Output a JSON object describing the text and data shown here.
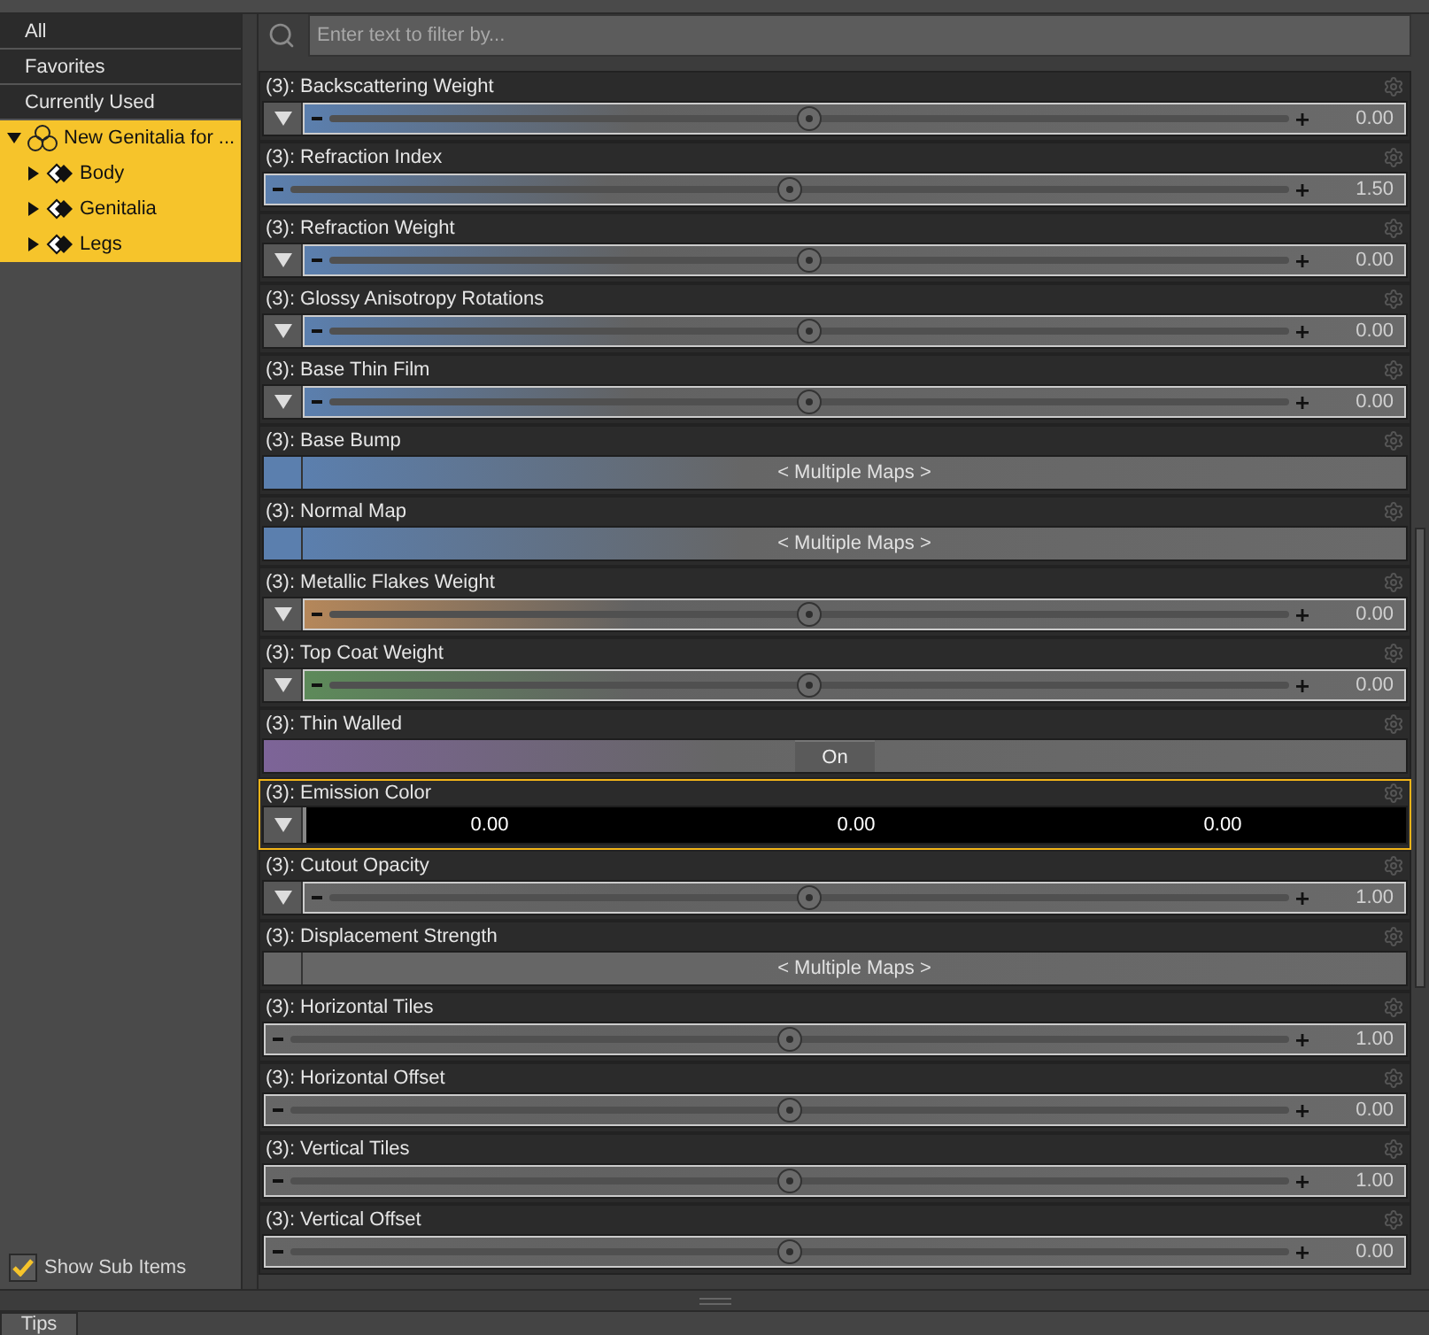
{
  "sidebar": {
    "items": [
      {
        "label": "All",
        "selected": false
      },
      {
        "label": "Favorites",
        "selected": false
      },
      {
        "label": "Currently Used",
        "selected": false
      }
    ],
    "tree": [
      {
        "label": "New Genitalia for ...",
        "selected": true,
        "expanded": true,
        "children": [
          {
            "label": "Body",
            "selected": true,
            "expanded": false
          },
          {
            "label": "Genitalia",
            "selected": true,
            "expanded": false
          },
          {
            "label": "Legs",
            "selected": true,
            "expanded": false
          }
        ]
      }
    ],
    "show_sub_items": {
      "label": "Show Sub Items",
      "checked": true
    }
  },
  "search": {
    "placeholder": "Enter text to filter by..."
  },
  "properties": [
    {
      "kind": "slider",
      "label": "(3): Backscattering Weight",
      "menu": true,
      "color": "#5b7fae",
      "level": 0.5,
      "value": "0.00",
      "selected": false
    },
    {
      "kind": "slider",
      "label": "(3): Refraction Index",
      "menu": false,
      "color": "#5b7fae",
      "level": 0.5,
      "value": "1.50",
      "selected": false
    },
    {
      "kind": "slider",
      "label": "(3): Refraction Weight",
      "menu": true,
      "color": "#5b7fae",
      "level": 0.5,
      "value": "0.00",
      "selected": false
    },
    {
      "kind": "slider",
      "label": "(3): Glossy Anisotropy Rotations",
      "menu": true,
      "color": "#5b7fae",
      "level": 0.5,
      "value": "0.00",
      "selected": false
    },
    {
      "kind": "slider",
      "label": "(3): Base Thin Film",
      "menu": true,
      "color": "#5b7fae",
      "level": 0.5,
      "value": "0.00",
      "selected": false
    },
    {
      "kind": "map",
      "label": "(3): Base Bump",
      "color": "#5b7fae",
      "value": "< Multiple Maps >",
      "selected": false
    },
    {
      "kind": "map",
      "label": "(3): Normal Map",
      "color": "#5b7fae",
      "value": "< Multiple Maps >",
      "selected": false
    },
    {
      "kind": "slider",
      "label": "(3): Metallic Flakes Weight",
      "menu": true,
      "color": "#b5875a",
      "level": 0.5,
      "value": "0.00",
      "selected": false
    },
    {
      "kind": "slider",
      "label": "(3): Top Coat Weight",
      "menu": true,
      "color": "#5d8a5a",
      "level": 0.5,
      "value": "0.00",
      "selected": false
    },
    {
      "kind": "toggle",
      "label": "(3): Thin Walled",
      "color": "#7d6498",
      "value": "On",
      "selected": false
    },
    {
      "kind": "color",
      "label": "(3): Emission Color",
      "values": [
        "0.00",
        "0.00",
        "0.00"
      ],
      "selected": true
    },
    {
      "kind": "slider",
      "label": "(3): Cutout Opacity",
      "menu": true,
      "color": "#666666",
      "level": 0.5,
      "value": "1.00",
      "selected": false
    },
    {
      "kind": "map",
      "label": "(3): Displacement Strength",
      "color": "#666666",
      "value": "< Multiple Maps >",
      "selected": false
    },
    {
      "kind": "slider",
      "label": "(3): Horizontal Tiles",
      "menu": false,
      "color": "#666666",
      "level": 0.5,
      "value": "1.00",
      "selected": false
    },
    {
      "kind": "slider",
      "label": "(3): Horizontal Offset",
      "menu": false,
      "color": "#666666",
      "level": 0.5,
      "value": "0.00",
      "selected": false
    },
    {
      "kind": "slider",
      "label": "(3): Vertical Tiles",
      "menu": false,
      "color": "#666666",
      "level": 0.5,
      "value": "1.00",
      "selected": false
    },
    {
      "kind": "slider",
      "label": "(3): Vertical Offset",
      "menu": false,
      "color": "#666666",
      "level": 0.5,
      "value": "0.00",
      "selected": false
    }
  ],
  "footer": {
    "tab": "Tips"
  }
}
